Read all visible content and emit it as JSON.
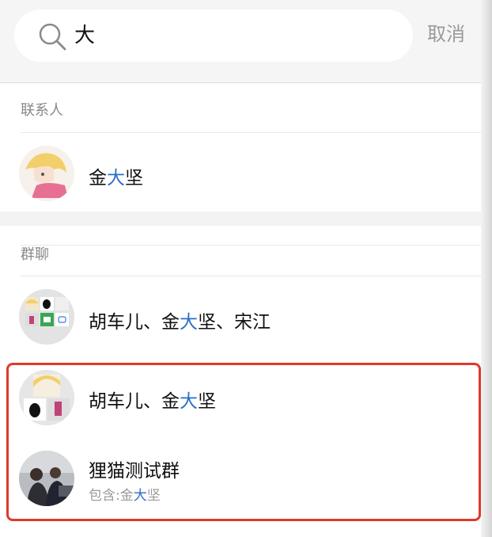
{
  "search": {
    "query": "大",
    "cancel_label": "取消"
  },
  "contacts": {
    "title": "联系人",
    "items": [
      {
        "name_pre": "金",
        "name_hl": "大",
        "name_post": "坚"
      }
    ]
  },
  "groups": {
    "title": "群聊",
    "items": [
      {
        "name_pre": "胡车儿、金",
        "name_hl": "大",
        "name_post": "坚、宋江"
      },
      {
        "name_pre": "胡车儿、金",
        "name_hl": "大",
        "name_post": "坚"
      },
      {
        "name": "狸猫测试群",
        "sub_pre": "包含:金",
        "sub_hl": "大",
        "sub_post": "坚"
      }
    ]
  },
  "colors": {
    "highlight_text": "#2a6fc9",
    "annotation_box": "#e0392b"
  }
}
